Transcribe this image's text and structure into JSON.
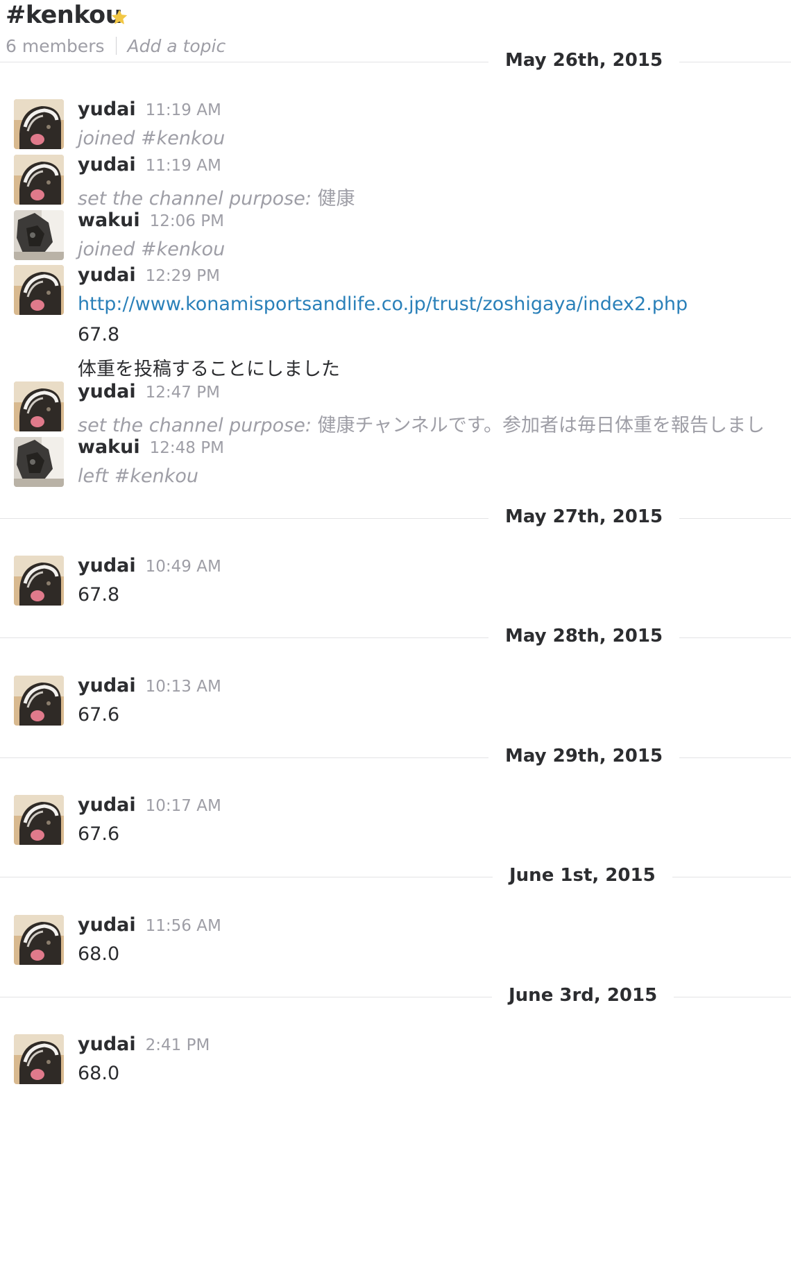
{
  "channel": {
    "name": "#kenkou",
    "members": "6 members",
    "topic_placeholder": "Add a topic",
    "star_color": "#f2c744"
  },
  "colors": {
    "link": "#2a80b9",
    "muted": "#9e9ea6",
    "text": "#2c2d30"
  },
  "days": [
    {
      "label": "May 26th, 2015"
    },
    {
      "label": "May 27th, 2015"
    },
    {
      "label": "May 28th, 2015"
    },
    {
      "label": "May 29th, 2015"
    },
    {
      "label": "June 1st, 2015"
    },
    {
      "label": "June 3rd, 2015"
    }
  ],
  "messages": [
    {
      "user": "yudai",
      "time": "11:19 AM",
      "lines": [
        {
          "style": "system",
          "text": "joined #kenkou"
        }
      ]
    },
    {
      "user": "yudai",
      "time": "11:19 AM",
      "lines": [
        {
          "style": "system",
          "text": "set the channel purpose:",
          "extra": "健康"
        }
      ]
    },
    {
      "user": "wakui",
      "time": "12:06 PM",
      "lines": [
        {
          "style": "system",
          "text": "joined #kenkou"
        }
      ]
    },
    {
      "user": "yudai",
      "time": "12:29 PM",
      "lines": [
        {
          "style": "link",
          "text": "http://www.konamisportsandlife.co.jp/trust/zoshigaya/index2.php"
        },
        {
          "style": "body",
          "text": "67.8"
        },
        {
          "style": "body",
          "text": "体重を投稿することにしました"
        }
      ]
    },
    {
      "user": "yudai",
      "time": "12:47 PM",
      "lines": [
        {
          "style": "system",
          "text": "set the channel purpose:",
          "extra": "健康チャンネルです。参加者は毎日体重を報告しまし"
        }
      ]
    },
    {
      "user": "wakui",
      "time": "12:48 PM",
      "lines": [
        {
          "style": "system",
          "text": "left #kenkou"
        }
      ]
    },
    {
      "user": "yudai",
      "time": "10:49 AM",
      "lines": [
        {
          "style": "body",
          "text": "67.8"
        }
      ]
    },
    {
      "user": "yudai",
      "time": "10:13 AM",
      "lines": [
        {
          "style": "body",
          "text": "67.6"
        }
      ]
    },
    {
      "user": "yudai",
      "time": "10:17 AM",
      "lines": [
        {
          "style": "body",
          "text": "67.6"
        }
      ]
    },
    {
      "user": "yudai",
      "time": "11:56 AM",
      "lines": [
        {
          "style": "body",
          "text": "68.0"
        }
      ]
    },
    {
      "user": "yudai",
      "time": "2:41 PM",
      "lines": [
        {
          "style": "body",
          "text": "68.0"
        }
      ]
    }
  ]
}
